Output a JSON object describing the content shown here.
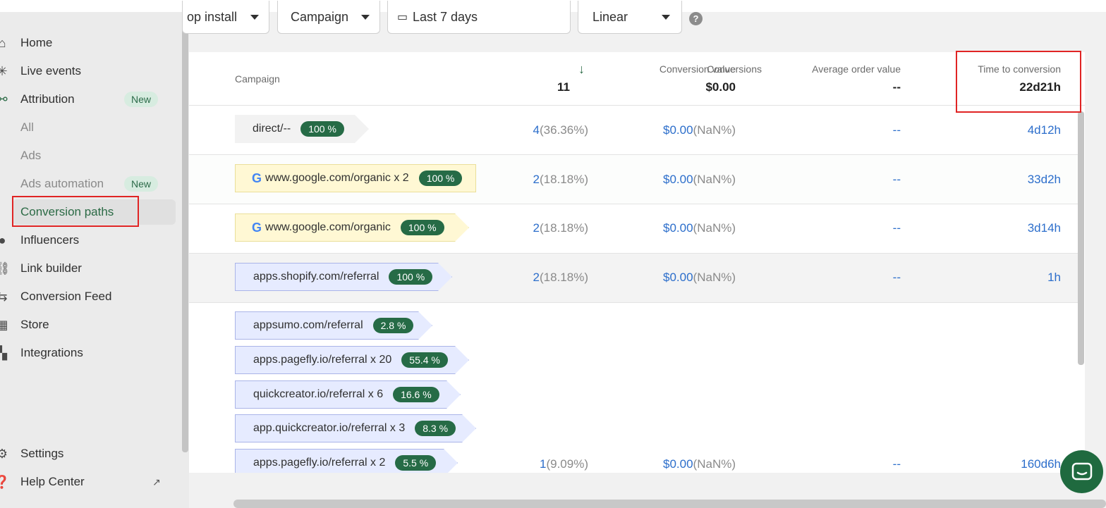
{
  "filters": {
    "event": "op install",
    "dimension": "Campaign",
    "date_range": "Last 7 days",
    "model": "Linear",
    "help": "?"
  },
  "sidebar": {
    "items": [
      {
        "label": "Home",
        "icon": "home-icon"
      },
      {
        "label": "Live events",
        "icon": "live-events-icon"
      },
      {
        "label": "Attribution",
        "icon": "attribution-icon",
        "badge": "New"
      },
      {
        "label": "All"
      },
      {
        "label": "Ads"
      },
      {
        "label": "Ads automation",
        "badge": "New"
      },
      {
        "label": "Conversion paths"
      },
      {
        "label": "Influencers",
        "icon": "palette-icon"
      },
      {
        "label": "Link builder",
        "icon": "link-icon"
      },
      {
        "label": "Conversion Feed",
        "icon": "arrows-icon"
      },
      {
        "label": "Store",
        "icon": "store-icon"
      },
      {
        "label": "Integrations",
        "icon": "apps-icon"
      }
    ],
    "footer": [
      {
        "label": "Settings",
        "icon": "gear-icon"
      },
      {
        "label": "Help Center",
        "icon": "help-circle-icon"
      }
    ]
  },
  "table": {
    "headers": {
      "campaign": "Campaign",
      "conversions": "Conversions",
      "conversion_value": "Conversion value",
      "avg_order_value": "Average order value",
      "time_to_conversion": "Time to conversion"
    },
    "totals": {
      "conversions": "11",
      "conversion_value": "$0.00",
      "avg_order_value": "--",
      "time_to_conversion": "22d21h"
    },
    "rows": [
      {
        "path": [
          {
            "label": "direct/--",
            "pct": "100 %"
          }
        ],
        "conversions": "4",
        "conv_pct": "(36.36%)",
        "value": "$0.00",
        "value_pct": "(NaN%)",
        "aov": "--",
        "time": "4d12h"
      },
      {
        "path": [
          {
            "label": "www.google.com/organic",
            "multiplier": "x 2",
            "pct": "100 %"
          }
        ],
        "conversions": "2",
        "conv_pct": "(18.18%)",
        "value": "$0.00",
        "value_pct": "(NaN%)",
        "aov": "--",
        "time": "33d2h"
      },
      {
        "path": [
          {
            "label": "www.google.com/organic",
            "pct": "100 %"
          }
        ],
        "conversions": "2",
        "conv_pct": "(18.18%)",
        "value": "$0.00",
        "value_pct": "(NaN%)",
        "aov": "--",
        "time": "3d14h"
      },
      {
        "path": [
          {
            "label": "apps.shopify.com/referral",
            "pct": "100 %"
          }
        ],
        "conversions": "2",
        "conv_pct": "(18.18%)",
        "value": "$0.00",
        "value_pct": "(NaN%)",
        "aov": "--",
        "time": "1h"
      },
      {
        "path": [
          {
            "label": "appsumo.com/referral",
            "pct": "2.8 %"
          },
          {
            "label": "apps.pagefly.io/referral",
            "multiplier": "x 20",
            "pct": "55.4 %"
          },
          {
            "label": "quickcreator.io/referral",
            "multiplier": "x 6",
            "pct": "16.6 %"
          },
          {
            "label": "app.quickcreator.io/referral",
            "multiplier": "x 3",
            "pct": "8.3 %"
          },
          {
            "label": "apps.pagefly.io/referral",
            "multiplier": "x 2",
            "pct": "5.5 %"
          }
        ],
        "conversions": "1",
        "conv_pct": "(9.09%)",
        "value": "$0.00",
        "value_pct": "(NaN%)",
        "aov": "--",
        "time": "160d6h"
      }
    ]
  },
  "colors": {
    "accent_green": "#266b46",
    "link_blue": "#2c6ecb",
    "highlight_red": "#e02424"
  }
}
